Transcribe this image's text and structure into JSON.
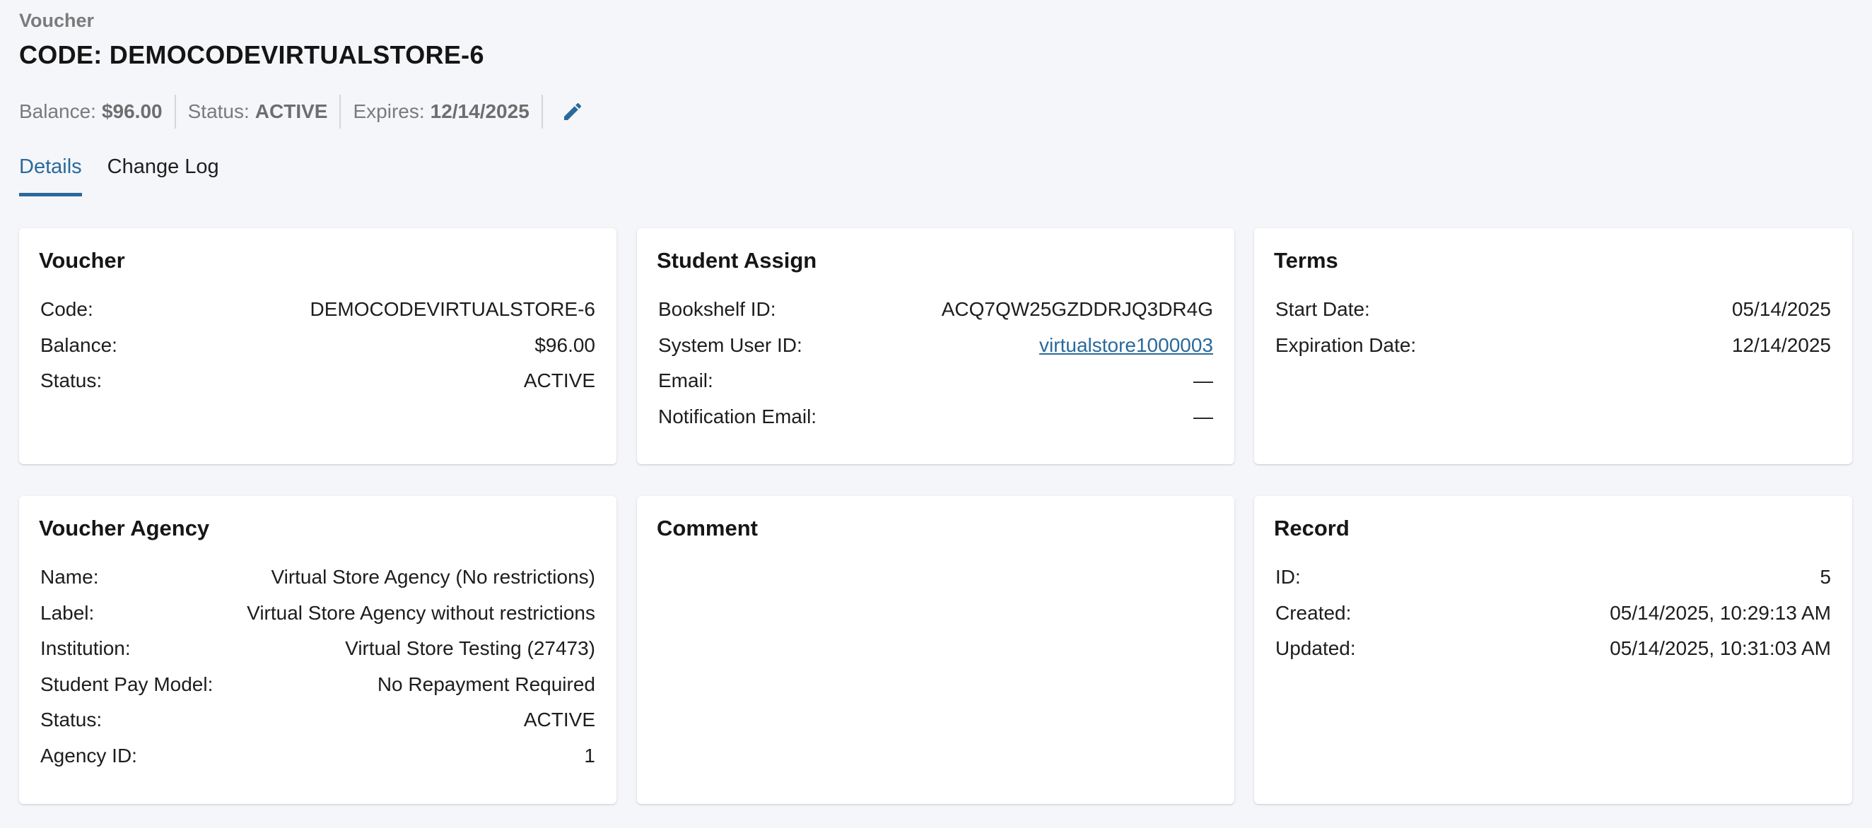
{
  "header": {
    "eyebrow": "Voucher",
    "title": "CODE: DEMOCODEVIRTUALSTORE-6"
  },
  "summary": {
    "balance_label": "Balance:",
    "balance_value": "$96.00",
    "status_label": "Status:",
    "status_value": "ACTIVE",
    "expires_label": "Expires:",
    "expires_value": "12/14/2025",
    "edit_icon": "pencil-icon"
  },
  "tabs": [
    {
      "label": "Details",
      "active": true
    },
    {
      "label": "Change Log",
      "active": false
    }
  ],
  "voucher": {
    "title": "Voucher",
    "code_label": "Code:",
    "code_value": "DEMOCODEVIRTUALSTORE-6",
    "balance_label": "Balance:",
    "balance_value": "$96.00",
    "status_label": "Status:",
    "status_value": "ACTIVE"
  },
  "student_assign": {
    "title": "Student Assign",
    "bookshelf_label": "Bookshelf ID:",
    "bookshelf_value": "ACQ7QW25GZDDRJQ3DR4G",
    "system_user_label": "System User ID:",
    "system_user_value": "virtualstore1000003",
    "email_label": "Email:",
    "email_value": "—",
    "notification_label": "Notification Email:",
    "notification_value": "—"
  },
  "terms": {
    "title": "Terms",
    "start_label": "Start Date:",
    "start_value": "05/14/2025",
    "expiration_label": "Expiration Date:",
    "expiration_value": "12/14/2025"
  },
  "agency": {
    "title": "Voucher Agency",
    "name_label": "Name:",
    "name_value": "Virtual Store Agency (No restrictions)",
    "label_label": "Label:",
    "label_value": "Virtual Store Agency without restrictions",
    "institution_label": "Institution:",
    "institution_value": "Virtual Store Testing (27473)",
    "pay_model_label": "Student Pay Model:",
    "pay_model_value": "No Repayment Required",
    "status_label": "Status:",
    "status_value": "ACTIVE",
    "agency_id_label": "Agency ID:",
    "agency_id_value": "1"
  },
  "comment": {
    "title": "Comment"
  },
  "record": {
    "title": "Record",
    "id_label": "ID:",
    "id_value": "5",
    "created_label": "Created:",
    "created_value": "05/14/2025, 10:29:13 AM",
    "updated_label": "Updated:",
    "updated_value": "05/14/2025, 10:31:03 AM"
  },
  "colors": {
    "accent": "#2a6a9b",
    "background": "#f5f6fa",
    "card": "#ffffff",
    "muted_text": "#7a7a7a"
  }
}
